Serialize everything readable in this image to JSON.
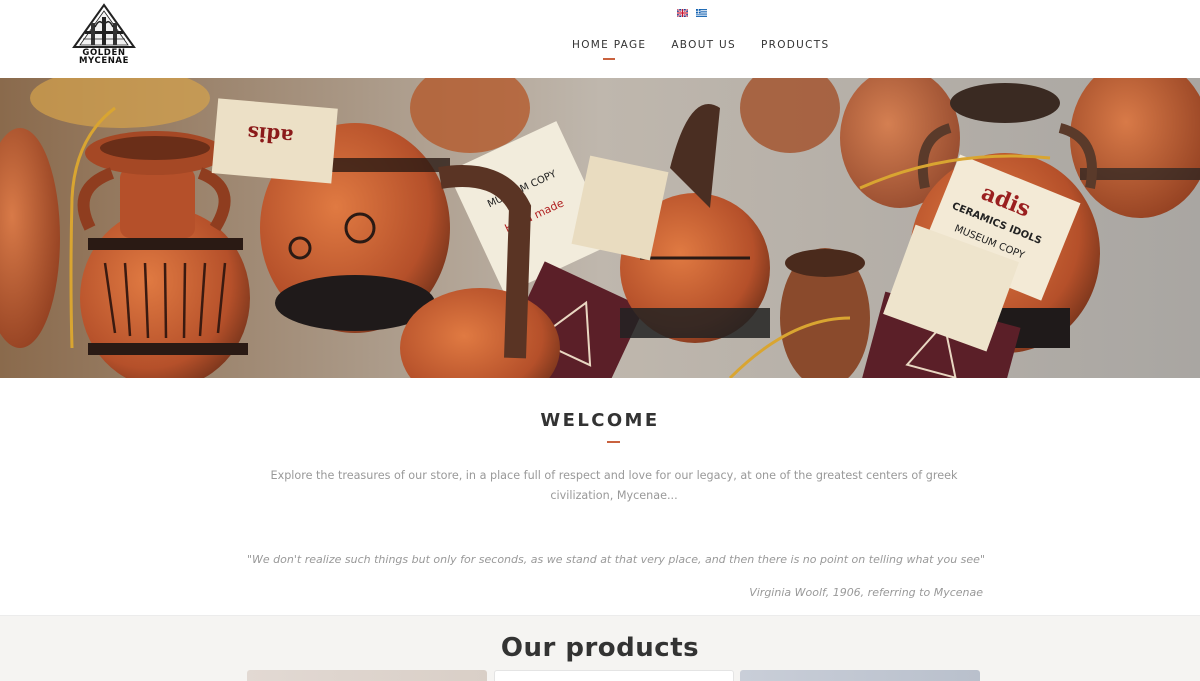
{
  "brand": {
    "logo_line1": "GOLDEN",
    "logo_line2": "MYCENAE"
  },
  "languages": [
    {
      "code": "en",
      "icon": "uk-flag-icon"
    },
    {
      "code": "el",
      "icon": "greek-flag-icon"
    }
  ],
  "nav": {
    "items": [
      {
        "label": "HOME PAGE",
        "active": true
      },
      {
        "label": "ABOUT US",
        "active": false
      },
      {
        "label": "PRODUCTS",
        "active": false
      }
    ]
  },
  "hero": {
    "tags": [
      {
        "line1": "adis",
        "line2": "CERAMICS IDOLS",
        "line3": "MUSEUM COPY",
        "line4": "Hand made in Greece"
      }
    ]
  },
  "welcome": {
    "title": "WELCOME",
    "text": "Explore the treasures of our store, in a place full of respect and love for our legacy, at one of the greatest centers of greek civilization, Mycenae...",
    "quote": "\"We don't realize such things but only for seconds, as we stand at that very place, and then there is no point on telling what you see\"",
    "quote_author": "Virginia Woolf, 1906, referring to Mycenae"
  },
  "products": {
    "title": "Our products"
  },
  "colors": {
    "accent": "#c9623f",
    "text": "#333333",
    "muted": "#999999"
  }
}
